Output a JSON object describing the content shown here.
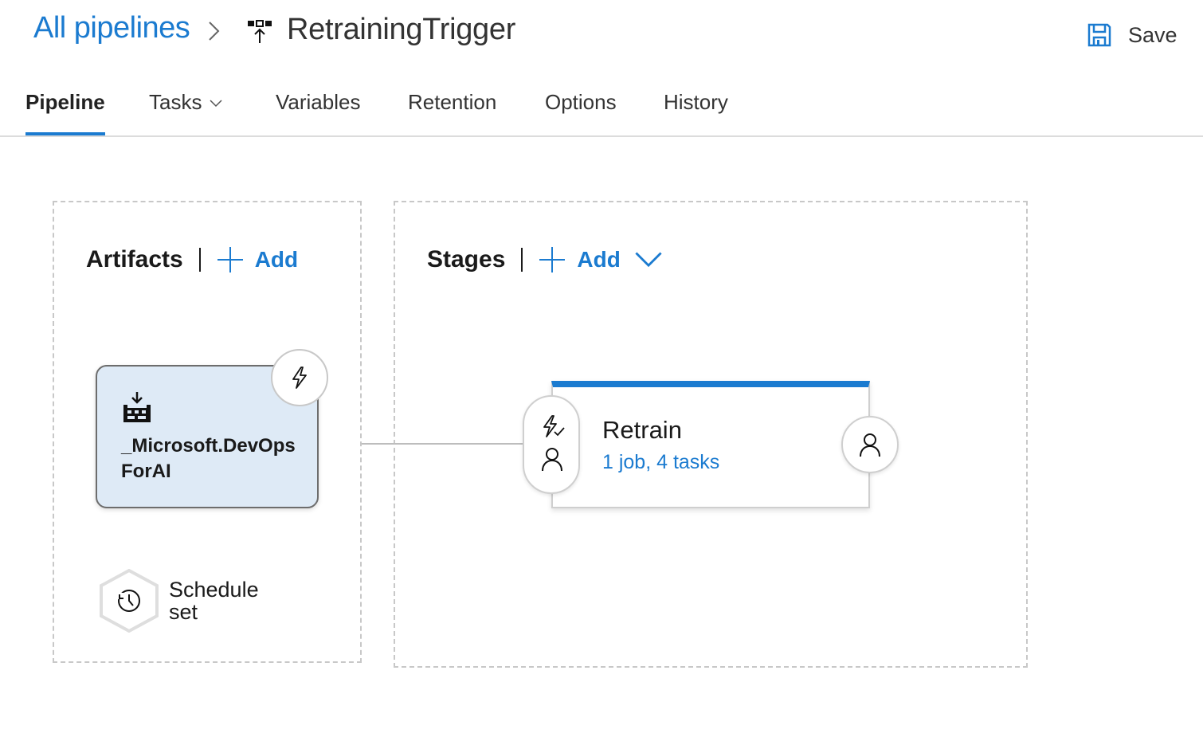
{
  "header": {
    "breadcrumb_root": "All pipelines",
    "title": "RetrainingTrigger",
    "title_icon": "release-pipeline-icon",
    "save_label": "Save",
    "save_icon": "save-icon"
  },
  "tabs": [
    {
      "label": "Pipeline",
      "active": true
    },
    {
      "label": "Tasks",
      "active": false,
      "has_dropdown": true
    },
    {
      "label": "Variables",
      "active": false
    },
    {
      "label": "Retention",
      "active": false
    },
    {
      "label": "Options",
      "active": false
    },
    {
      "label": "History",
      "active": false
    }
  ],
  "artifacts": {
    "title": "Artifacts",
    "add_label": "Add",
    "items": [
      {
        "name": "_Microsoft.DevOpsForAI",
        "icon": "build-artifact-icon",
        "trigger_icon": "lightning-icon"
      }
    ],
    "schedule": {
      "label": "Schedule set",
      "icon": "schedule-history-icon"
    }
  },
  "stages": {
    "title": "Stages",
    "add_label": "Add",
    "items": [
      {
        "name": "Retrain",
        "summary": "1 job, 4 tasks",
        "pre_icons": [
          "trigger-check-icon",
          "person-icon"
        ],
        "post_icon": "person-icon"
      }
    ]
  },
  "colors": {
    "accent": "#1b7bd0",
    "artifact_bg": "#deeaf6",
    "dashed_border": "#c8c8c8"
  }
}
